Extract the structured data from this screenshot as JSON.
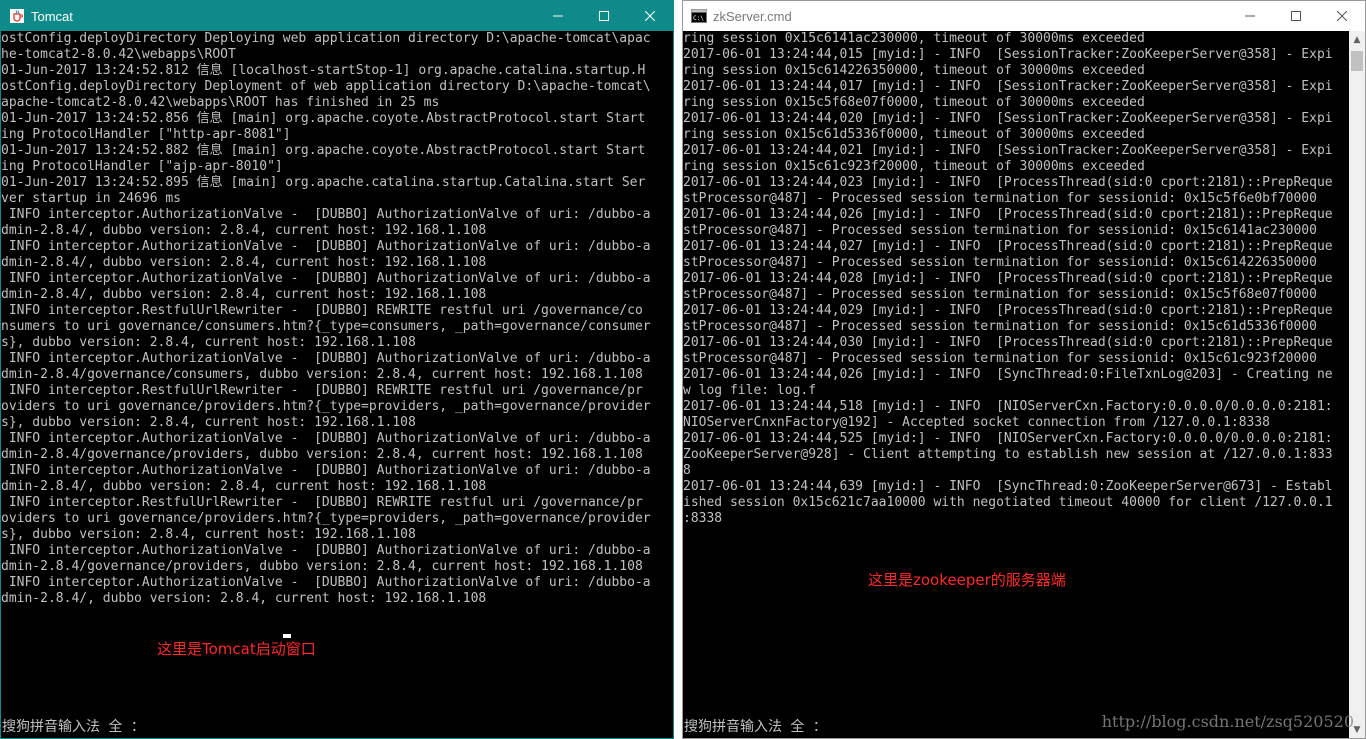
{
  "tomcat_window": {
    "title": "Tomcat",
    "icon": "java-cup-icon",
    "accent": "#0f8a8a",
    "lines": [
      "ostConfig.deployDirectory Deploying web application directory D:\\apache-tomcat\\apac",
      "he-tomcat2-8.0.42\\webapps\\ROOT",
      "01-Jun-2017 13:24:52.812 信息 [localhost-startStop-1] org.apache.catalina.startup.H",
      "ostConfig.deployDirectory Deployment of web application directory D:\\apache-tomcat\\",
      "apache-tomcat2-8.0.42\\webapps\\ROOT has finished in 25 ms",
      "01-Jun-2017 13:24:52.856 信息 [main] org.apache.coyote.AbstractProtocol.start Start",
      "ing ProtocolHandler [\"http-apr-8081\"]",
      "01-Jun-2017 13:24:52.882 信息 [main] org.apache.coyote.AbstractProtocol.start Start",
      "ing ProtocolHandler [\"ajp-apr-8010\"]",
      "01-Jun-2017 13:24:52.895 信息 [main] org.apache.catalina.startup.Catalina.start Ser",
      "ver startup in 24696 ms",
      " INFO interceptor.AuthorizationValve -  [DUBBO] AuthorizationValve of uri: /dubbo-a",
      "dmin-2.8.4/, dubbo version: 2.8.4, current host: 192.168.1.108",
      " INFO interceptor.AuthorizationValve -  [DUBBO] AuthorizationValve of uri: /dubbo-a",
      "dmin-2.8.4/, dubbo version: 2.8.4, current host: 192.168.1.108",
      " INFO interceptor.AuthorizationValve -  [DUBBO] AuthorizationValve of uri: /dubbo-a",
      "dmin-2.8.4/, dubbo version: 2.8.4, current host: 192.168.1.108",
      " INFO interceptor.RestfulUrlRewriter -  [DUBBO] REWRITE restful uri /governance/co",
      "nsumers to uri governance/consumers.htm?{_type=consumers, _path=governance/consumer",
      "s}, dubbo version: 2.8.4, current host: 192.168.1.108",
      " INFO interceptor.AuthorizationValve -  [DUBBO] AuthorizationValve of uri: /dubbo-a",
      "dmin-2.8.4/governance/consumers, dubbo version: 2.8.4, current host: 192.168.1.108",
      " INFO interceptor.RestfulUrlRewriter -  [DUBBO] REWRITE restful uri /governance/pr",
      "oviders to uri governance/providers.htm?{_type=providers, _path=governance/provider",
      "s}, dubbo version: 2.8.4, current host: 192.168.1.108",
      " INFO interceptor.AuthorizationValve -  [DUBBO] AuthorizationValve of uri: /dubbo-a",
      "dmin-2.8.4/governance/providers, dubbo version: 2.8.4, current host: 192.168.1.108",
      " INFO interceptor.AuthorizationValve -  [DUBBO] AuthorizationValve of uri: /dubbo-a",
      "dmin-2.8.4/, dubbo version: 2.8.4, current host: 192.168.1.108",
      " INFO interceptor.RestfulUrlRewriter -  [DUBBO] REWRITE restful uri /governance/pr",
      "oviders to uri governance/providers.htm?{_type=providers, _path=governance/provider",
      "s}, dubbo version: 2.8.4, current host: 192.168.1.108",
      " INFO interceptor.AuthorizationValve -  [DUBBO] AuthorizationValve of uri: /dubbo-a",
      "dmin-2.8.4/governance/providers, dubbo version: 2.8.4, current host: 192.168.1.108",
      " INFO interceptor.AuthorizationValve -  [DUBBO] AuthorizationValve of uri: /dubbo-a",
      "dmin-2.8.4/, dubbo version: 2.8.4, current host: 192.168.1.108"
    ],
    "annotation": "这里是Tomcat启动窗口",
    "ime_status": "搜狗拼音输入法 全 ："
  },
  "zk_window": {
    "title": "zkServer.cmd",
    "icon": "cmd-icon",
    "lines": [
      "ring session 0x15c6141ac230000, timeout of 30000ms exceeded",
      "2017-06-01 13:24:44,015 [myid:] - INFO  [SessionTracker:ZooKeeperServer@358] - Expi",
      "ring session 0x15c614226350000, timeout of 30000ms exceeded",
      "2017-06-01 13:24:44,017 [myid:] - INFO  [SessionTracker:ZooKeeperServer@358] - Expi",
      "ring session 0x15c5f68e07f0000, timeout of 30000ms exceeded",
      "2017-06-01 13:24:44,020 [myid:] - INFO  [SessionTracker:ZooKeeperServer@358] - Expi",
      "ring session 0x15c61d5336f0000, timeout of 30000ms exceeded",
      "2017-06-01 13:24:44,021 [myid:] - INFO  [SessionTracker:ZooKeeperServer@358] - Expi",
      "ring session 0x15c61c923f20000, timeout of 30000ms exceeded",
      "2017-06-01 13:24:44,023 [myid:] - INFO  [ProcessThread(sid:0 cport:2181)::PrepReque",
      "stProcessor@487] - Processed session termination for sessionid: 0x15c5f6e0bf70000",
      "2017-06-01 13:24:44,026 [myid:] - INFO  [ProcessThread(sid:0 cport:2181)::PrepReque",
      "stProcessor@487] - Processed session termination for sessionid: 0x15c6141ac230000",
      "2017-06-01 13:24:44,027 [myid:] - INFO  [ProcessThread(sid:0 cport:2181)::PrepReque",
      "stProcessor@487] - Processed session termination for sessionid: 0x15c614226350000",
      "2017-06-01 13:24:44,028 [myid:] - INFO  [ProcessThread(sid:0 cport:2181)::PrepReque",
      "stProcessor@487] - Processed session termination for sessionid: 0x15c5f68e07f0000",
      "2017-06-01 13:24:44,029 [myid:] - INFO  [ProcessThread(sid:0 cport:2181)::PrepReque",
      "stProcessor@487] - Processed session termination for sessionid: 0x15c61d5336f0000",
      "2017-06-01 13:24:44,030 [myid:] - INFO  [ProcessThread(sid:0 cport:2181)::PrepReque",
      "stProcessor@487] - Processed session termination for sessionid: 0x15c61c923f20000",
      "2017-06-01 13:24:44,026 [myid:] - INFO  [SyncThread:0:FileTxnLog@203] - Creating ne",
      "w log file: log.f",
      "2017-06-01 13:24:44,518 [myid:] - INFO  [NIOServerCxn.Factory:0.0.0.0/0.0.0.0:2181:",
      "NIOServerCnxnFactory@192] - Accepted socket connection from /127.0.0.1:8338",
      "2017-06-01 13:24:44,525 [myid:] - INFO  [NIOServerCxn.Factory:0.0.0.0/0.0.0.0:2181:",
      "ZooKeeperServer@928] - Client attempting to establish new session at /127.0.0.1:833",
      "8",
      "2017-06-01 13:24:44,639 [myid:] - INFO  [SyncThread:0:ZooKeeperServer@673] - Establ",
      "ished session 0x15c621c7aa10000 with negotiated timeout 40000 for client /127.0.0.1",
      ":8338"
    ],
    "annotation": "这里是zookeeper的服务器端",
    "ime_status": "搜狗拼音输入法 全 ："
  },
  "watermark": "http://blog.csdn.net/zsq520520",
  "colors": {
    "console_bg": "#000000",
    "console_text": "#c0c0c0",
    "annotation": "#ff2a2a"
  }
}
